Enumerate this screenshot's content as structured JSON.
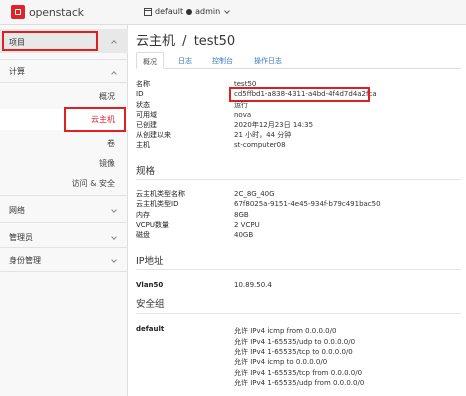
{
  "topbar": {
    "brand": "openstack",
    "project": "default",
    "user": "admin"
  },
  "sidebar": {
    "project": "项目",
    "compute": "计算",
    "overview": "概况",
    "instances": "云主机",
    "volumes": "卷",
    "images": "镜像",
    "access_security": "访问 & 安全",
    "network": "网络",
    "admin": "管理员",
    "identity": "身份管理"
  },
  "main": {
    "breadcrumb": "云主机",
    "separator": "/",
    "instance_name": "test50",
    "tabs": [
      "概况",
      "日志",
      "控制台",
      "操作日志"
    ]
  },
  "overview": [
    {
      "key": "名称",
      "value": "test50"
    },
    {
      "key": "ID",
      "value": "cd5ffbd1-a838-4311-a4bd-4f4d7d4a2fca"
    },
    {
      "key": "状态",
      "value": "运行"
    },
    {
      "key": "可用域",
      "value": "nova"
    },
    {
      "key": "已创建",
      "value": "2020年12月23日 14:35"
    },
    {
      "key": "从创建以来",
      "value": "21 小时，44 分钟"
    },
    {
      "key": "主机",
      "value": "st-computer08"
    }
  ],
  "specs": {
    "title": "规格",
    "rows": [
      {
        "key": "云主机类型名称",
        "value": "2C_8G_40G"
      },
      {
        "key": "云主机类型ID",
        "value": "67f8025a-9151-4e45-934f-b79c491bac50"
      },
      {
        "key": "内存",
        "value": "8GB"
      },
      {
        "key": "VCPU数量",
        "value": "2 VCPU"
      },
      {
        "key": "磁盘",
        "value": "40GB"
      }
    ]
  },
  "ip": {
    "title": "IP地址",
    "key": "Vlan50",
    "value": "10.89.50.4"
  },
  "security": {
    "title": "安全组",
    "group": "default",
    "rules": [
      "允许 IPv4 icmp from 0.0.0.0/0",
      "允许 IPv4 1-65535/udp to 0.0.0.0/0",
      "允许 IPv4 1-65535/tcp to 0.0.0.0/0",
      "允许 IPv4 icmp to 0.0.0.0/0",
      "允许 IPv4 1-65535/tcp from 0.0.0.0/0",
      "允许 IPv4 1-65535/udp from 0.0.0.0/0"
    ]
  },
  "colors": {
    "accent": "#d9252b",
    "link": "#3a7bbf",
    "highlight_box": "#e02020"
  }
}
